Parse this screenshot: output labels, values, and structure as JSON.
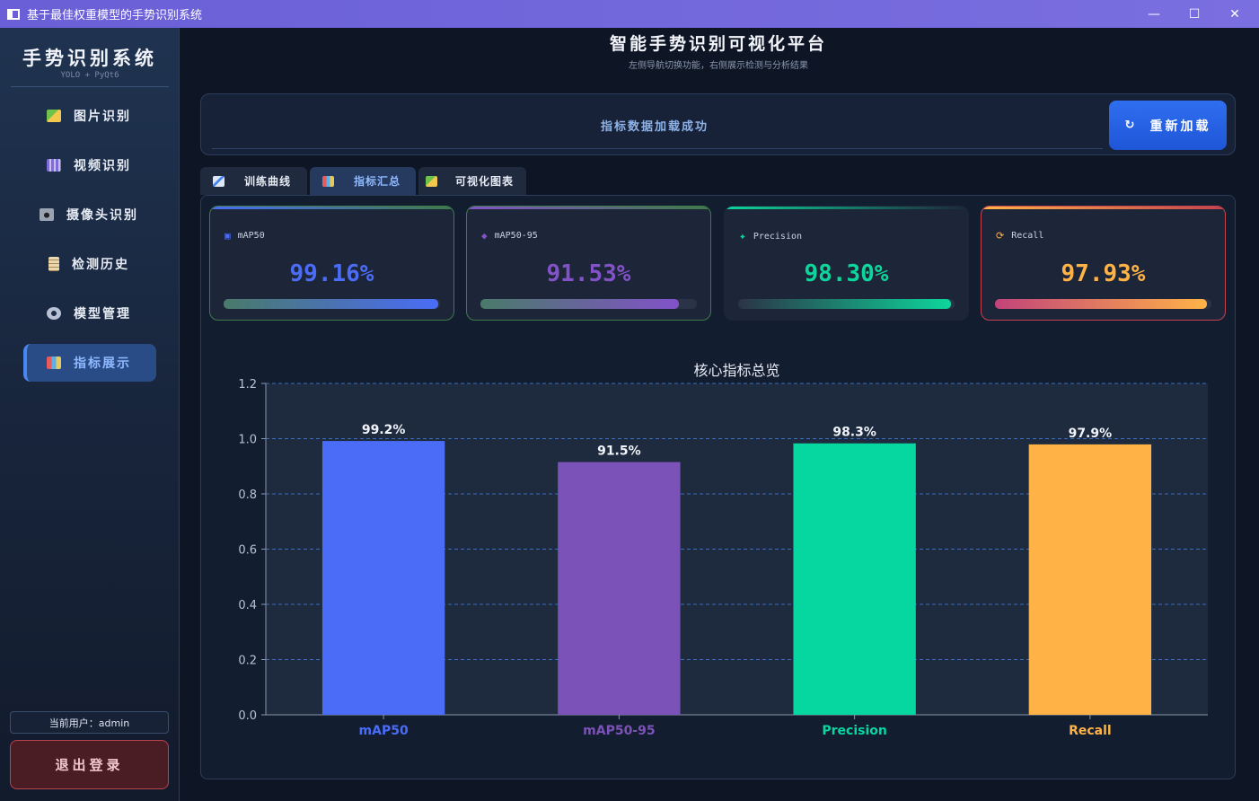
{
  "window": {
    "title": "基于最佳权重模型的手势识别系统",
    "controls": [
      "—",
      "☐",
      "✕"
    ]
  },
  "sidebar": {
    "brand": "手势识别系统",
    "brand_sub": "YOLO + PyQt6",
    "items": [
      {
        "label": "图片识别",
        "icon": "image-icon"
      },
      {
        "label": "视频识别",
        "icon": "film-icon"
      },
      {
        "label": "摄像头识别",
        "icon": "camera-icon"
      },
      {
        "label": "检测历史",
        "icon": "clipboard-icon"
      },
      {
        "label": "模型管理",
        "icon": "gear-icon"
      },
      {
        "label": "指标展示",
        "icon": "bar-chart-icon",
        "active": true
      }
    ],
    "user_label": "当前用户：admin",
    "logout_label": "退出登录"
  },
  "header": {
    "title": "智能手势识别可视化平台",
    "subtitle": "左侧导航切换功能，右侧展示检测与分析结果"
  },
  "status": {
    "message": "指标数据加载成功",
    "reload_label": "重新加载",
    "reload_icon": "↻"
  },
  "tabs": [
    {
      "label": "训练曲线",
      "icon": "line-chart-icon"
    },
    {
      "label": "指标汇总",
      "icon": "bar-chart-icon",
      "active": true
    },
    {
      "label": "可视化图表",
      "icon": "image-icon"
    }
  ],
  "cards": [
    {
      "label": "mAP50",
      "icon": "▣",
      "value": "99.16%",
      "fraction": 0.9916,
      "color": "#4a6cf7"
    },
    {
      "label": "mAP50-95",
      "icon": "◆",
      "value": "91.53%",
      "fraction": 0.9153,
      "color": "#8252c9"
    },
    {
      "label": "Precision",
      "icon": "✦",
      "value": "98.30%",
      "fraction": 0.983,
      "color": "#0dd69c"
    },
    {
      "label": "Recall",
      "icon": "⟳",
      "value": "97.93%",
      "fraction": 0.9793,
      "color": "#ffb347"
    }
  ],
  "chart_data": {
    "type": "bar",
    "title": "核心指标总览",
    "categories": [
      "mAP50",
      "mAP50-95",
      "Precision",
      "Recall"
    ],
    "values": [
      0.9916,
      0.9153,
      0.983,
      0.9793
    ],
    "data_labels": [
      "99.2%",
      "91.5%",
      "98.3%",
      "97.9%"
    ],
    "colors": [
      "#4a6cf7",
      "#7b52b8",
      "#06d6a0",
      "#ffb347"
    ],
    "ylim": [
      0,
      1.2
    ],
    "yticks": [
      "0.0",
      "0.2",
      "0.4",
      "0.6",
      "0.8",
      "1.0",
      "1.2"
    ],
    "grid": true
  }
}
